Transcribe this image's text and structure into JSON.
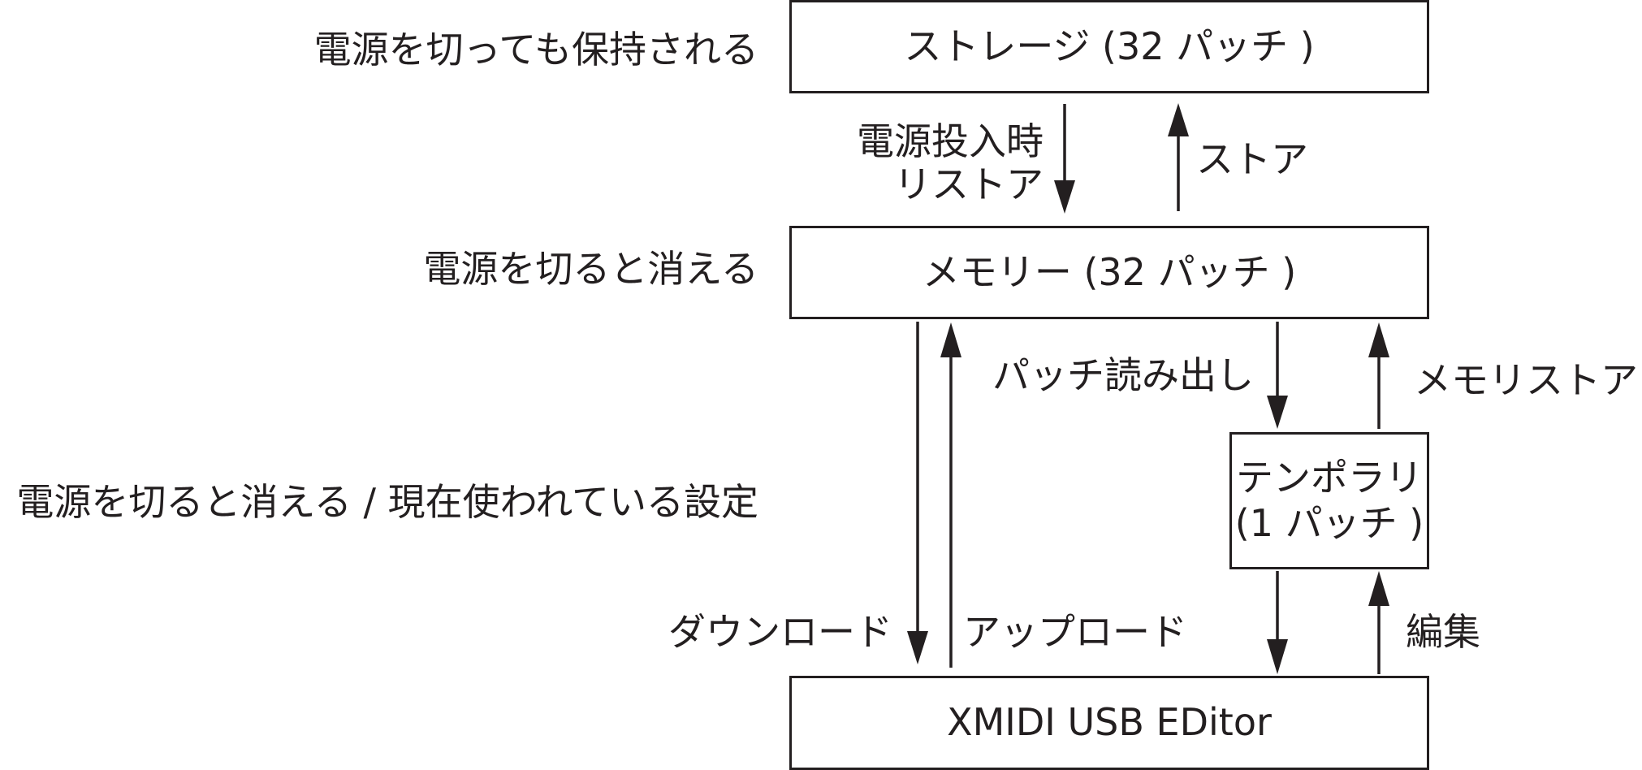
{
  "boxes": {
    "storage": "ストレージ (32 パッチ )",
    "memory": "メモリー (32 パッチ )",
    "temporary_line1": "テンポラリ",
    "temporary_line2": "(1 パッチ )",
    "editor": "XMIDI USB EDitor"
  },
  "side_labels": {
    "storage": "電源を切っても保持される",
    "memory": "電源を切ると消える",
    "temporary": "電源を切ると消える / 現在使われている設定"
  },
  "arrow_labels": {
    "restore_line1": "電源投入時",
    "restore_line2": "リストア",
    "store": "ストア",
    "patch_read": "パッチ読み出し",
    "memory_store": "メモリストア",
    "download": "ダウンロード",
    "upload": "アップロード",
    "edit": "編集"
  }
}
